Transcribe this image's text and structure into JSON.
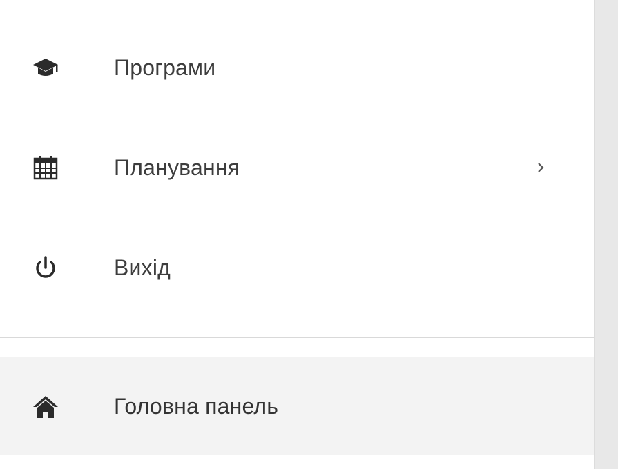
{
  "menu": {
    "items": [
      {
        "label": "Програми",
        "icon": "graduation-cap-icon"
      },
      {
        "label": "Планування",
        "icon": "calendar-icon",
        "has_submenu": true
      },
      {
        "label": "Вихід",
        "icon": "power-icon"
      }
    ],
    "active_item": {
      "label": "Головна панель",
      "icon": "home-icon"
    }
  },
  "colors": {
    "text": "#3d3d3d",
    "icon": "#2b2b2b",
    "active_bg": "#f3f3f3",
    "divider": "#d9d9d9",
    "gutter": "#e8e8e8"
  }
}
